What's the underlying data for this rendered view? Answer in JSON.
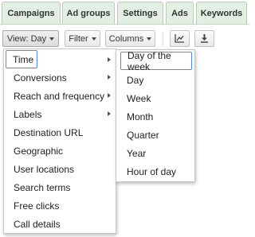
{
  "tabs": [
    "Campaigns",
    "Ad groups",
    "Settings",
    "Ads",
    "Keywords"
  ],
  "toolbar": {
    "view_label": "View: Day",
    "filter_label": "Filter",
    "columns_label": "Columns",
    "chart_icon": "line-chart-icon",
    "download_icon": "download-icon"
  },
  "segment_menu": {
    "items": [
      "Time",
      "Conversions",
      "Reach and frequency",
      "Labels",
      "Destination URL",
      "Geographic",
      "User locations",
      "Search terms",
      "Free clicks",
      "Call details"
    ],
    "selected": "Time"
  },
  "time_submenu": {
    "items": [
      "Day of the week",
      "Day",
      "Week",
      "Month",
      "Quarter",
      "Year",
      "Hour of day"
    ],
    "selected": "Day of the week"
  },
  "colors": {
    "tab_background": "#e3efe3",
    "selection_border": "#4d8ce4"
  }
}
